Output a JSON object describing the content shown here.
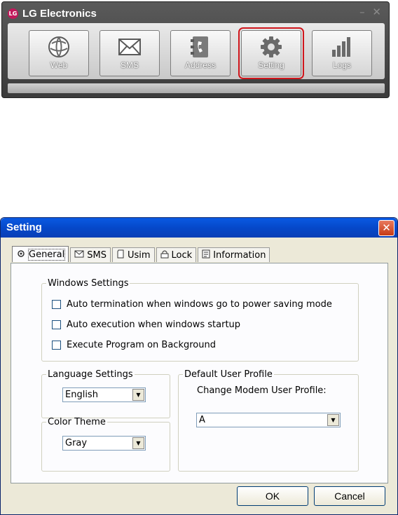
{
  "launcher": {
    "title": "LG Electronics",
    "logo": "LG",
    "window_controls": "– ✕",
    "buttons": [
      {
        "label": "Web",
        "icon": "globe-icon"
      },
      {
        "label": "SMS",
        "icon": "envelope-icon"
      },
      {
        "label": "Address",
        "icon": "phonebook-icon"
      },
      {
        "label": "Setting",
        "icon": "gear-icon",
        "selected": true
      },
      {
        "label": "Logs",
        "icon": "bar-chart-icon"
      }
    ],
    "highlight_color": "#d0161c"
  },
  "dialog": {
    "title": "Setting",
    "close": "✕",
    "tabs": [
      {
        "label": "General",
        "icon": "general-icon",
        "active": true
      },
      {
        "label": "SMS",
        "icon": "envelope-icon"
      },
      {
        "label": "Usim",
        "icon": "sim-icon"
      },
      {
        "label": "Lock",
        "icon": "lock-icon"
      },
      {
        "label": "Information",
        "icon": "info-doc-icon"
      }
    ],
    "windows_settings": {
      "legend": "Windows Settings",
      "options": [
        {
          "label": "Auto termination when windows go to power saving mode",
          "checked": false
        },
        {
          "label": "Auto execution when windows startup",
          "checked": false
        },
        {
          "label": "Execute Program on Background",
          "checked": false
        }
      ]
    },
    "language_settings": {
      "legend": "Language Settings",
      "value": "English"
    },
    "color_theme": {
      "legend": "Color Theme",
      "value": "Gray"
    },
    "default_user_profile": {
      "legend": "Default User Profile",
      "label": "Change Modem User Profile:",
      "value": "A"
    },
    "ok_label": "OK",
    "cancel_label": "Cancel"
  }
}
